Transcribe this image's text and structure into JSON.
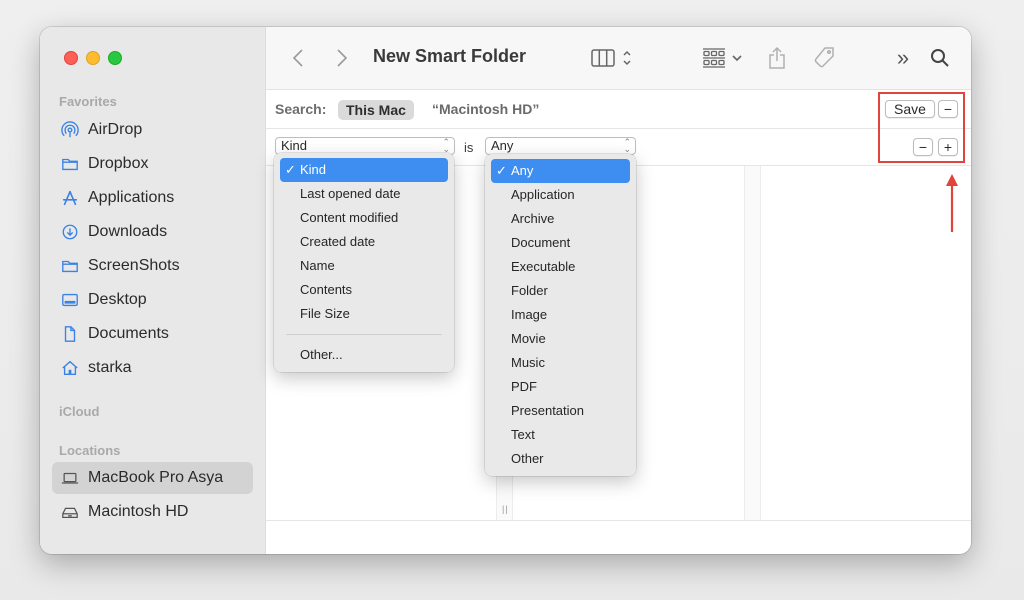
{
  "window": {
    "title": "New Smart Folder"
  },
  "sidebar": {
    "sections": {
      "favorites": "Favorites",
      "icloud": "iCloud",
      "locations": "Locations"
    },
    "favorites": [
      {
        "label": "AirDrop",
        "icon": "airdrop-icon"
      },
      {
        "label": "Dropbox",
        "icon": "folder-icon"
      },
      {
        "label": "Applications",
        "icon": "applications-icon"
      },
      {
        "label": "Downloads",
        "icon": "download-icon"
      },
      {
        "label": "ScreenShots",
        "icon": "folder-icon"
      },
      {
        "label": "Desktop",
        "icon": "desktop-icon"
      },
      {
        "label": "Documents",
        "icon": "document-icon"
      },
      {
        "label": "starka",
        "icon": "home-icon"
      }
    ],
    "locations": [
      {
        "label": "MacBook Pro Asya",
        "icon": "laptop-icon",
        "selected": true
      },
      {
        "label": "Macintosh HD",
        "icon": "disk-icon",
        "selected": false
      }
    ]
  },
  "toolbar": {
    "back": "back-icon",
    "forward": "forward-icon",
    "view": "column-view-icon",
    "group": "group-icon",
    "share": "share-icon",
    "tag": "tag-icon",
    "more": "»",
    "search": "search-icon"
  },
  "search": {
    "label": "Search:",
    "scope_selected": "This Mac",
    "scope_other": "“Macintosh HD”",
    "save_label": "Save",
    "remove_label": "−",
    "add_label": "+"
  },
  "criteria": {
    "attribute": "Kind",
    "operator": "is",
    "value": "Any"
  },
  "attribute_menu": {
    "items": [
      "Kind",
      "Last opened date",
      "Content modified",
      "Created date",
      "Name",
      "Contents",
      "File Size"
    ],
    "selected": "Kind",
    "footer": "Other..."
  },
  "kind_menu": {
    "items": [
      "Any",
      "Application",
      "Archive",
      "Document",
      "Executable",
      "Folder",
      "Image",
      "Movie",
      "Music",
      "PDF",
      "Presentation",
      "Text",
      "Other"
    ],
    "selected": "Any"
  },
  "colors": {
    "accent": "#3d8ef0",
    "sidebar_icon": "#3a82e4",
    "annotation": "#e0443a"
  },
  "checkmark": "✓"
}
